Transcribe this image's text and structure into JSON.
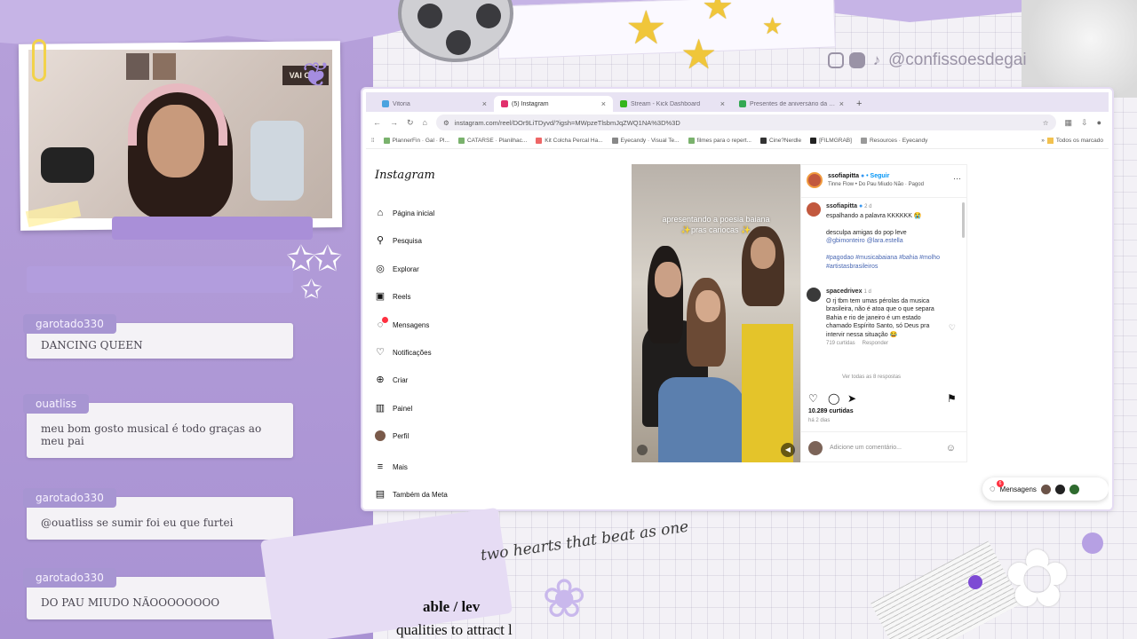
{
  "social": {
    "handle": "@confissoesdegai",
    "icons": [
      "instagram-icon",
      "youtube-icon",
      "tiktok-icon"
    ]
  },
  "webcam": {
    "sign_text": "VAI COR"
  },
  "chat": [
    {
      "user": "garotado330",
      "text": "DANCING QUEEN"
    },
    {
      "user": "ouatliss",
      "text": "meu bom gosto musical é todo graças ao meu pai"
    },
    {
      "user": "garotado330",
      "text": "@ouatliss se sumir foi eu que furtei"
    },
    {
      "user": "garotado330",
      "text": "DO PAU MIUDO NÃOOOOOOOO"
    }
  ],
  "browser": {
    "tabs": [
      {
        "label": "Vitoria",
        "color": "#4aa3df",
        "active": false
      },
      {
        "label": "(5) Instagram",
        "color": "#e1306c",
        "active": true
      },
      {
        "label": "Stream - Kick Dashboard",
        "color": "#53fc18",
        "active": false
      },
      {
        "label": "Presentes de aniversário da Ga...",
        "color": "#34a853",
        "active": false
      }
    ],
    "url": "instagram.com/reel/DOr9LiTDyvd/?igsh=MWpzeTlsbmJqZWQ1NA%3D%3D",
    "bookmarks": [
      "PlannerFin · Gal · Pl...",
      "CATARSE · Planilhac...",
      "Kit Colcha Percal Ha...",
      "Eyecandy · Visual Te...",
      "filmes para o repert...",
      "Cine?Nerdle",
      "[FILMGRAB]",
      "Resources · Eyecandy"
    ],
    "bookmarks_right": "Todos os marcado"
  },
  "instagram": {
    "logo": "Instagram",
    "nav": [
      {
        "label": "Página inicial",
        "icon": "home-icon"
      },
      {
        "label": "Pesquisa",
        "icon": "search-icon"
      },
      {
        "label": "Explorar",
        "icon": "compass-icon"
      },
      {
        "label": "Reels",
        "icon": "reels-icon"
      },
      {
        "label": "Mensagens",
        "icon": "messages-icon"
      },
      {
        "label": "Notificações",
        "icon": "heart-icon"
      },
      {
        "label": "Criar",
        "icon": "plus-icon"
      },
      {
        "label": "Painel",
        "icon": "dashboard-icon"
      },
      {
        "label": "Perfil",
        "icon": "profile-avatar"
      },
      {
        "label": "Mais",
        "icon": "menu-icon"
      },
      {
        "label": "Também da Meta",
        "icon": "meta-icon"
      }
    ],
    "reel": {
      "caption_line1": "apresentando a poesia baiana",
      "caption_line2": "✨pras cariocas ✨"
    },
    "post": {
      "username": "ssofiapitta",
      "verified": "●",
      "follow": "• Seguir",
      "audio": "Tinne Flow • Do Pau Miudo Não · Pagod",
      "caption_user": "ssofiapitta",
      "caption_time": "2 d",
      "caption_text": "espalhando a palavra KKKKKK 😭",
      "caption_text2": "desculpa amigas do pop leve",
      "mentions": "@gbimonteiro @lara.estella",
      "hashtags": "#pagodao #musicabaiana #bahia #molho #artistasbrasileiros",
      "comment_user": "spacedrivex",
      "comment_time": "1 d",
      "comment_text": "O rj tbm tem umas pérolas da musica brasileira, não é atoa que o que separa Bahia e rio de janeiro é um estado chamado Espírito Santo, só Deus pra intervir nessa situação 😂",
      "comment_likes": "719 curtidas",
      "comment_reply": "Responder",
      "view_replies": "Ver todas as 8 respostas",
      "likes": "10.289 curtidas",
      "date": "há 2 dias",
      "add_comment_placeholder": "Adicione um comentário..."
    },
    "messages_pill": {
      "label": "Mensagens",
      "badge": "6"
    }
  },
  "decor": {
    "handwriting": "two hearts that beat as one",
    "quote": "able  / lev",
    "quote2": "qualities to attract l"
  }
}
